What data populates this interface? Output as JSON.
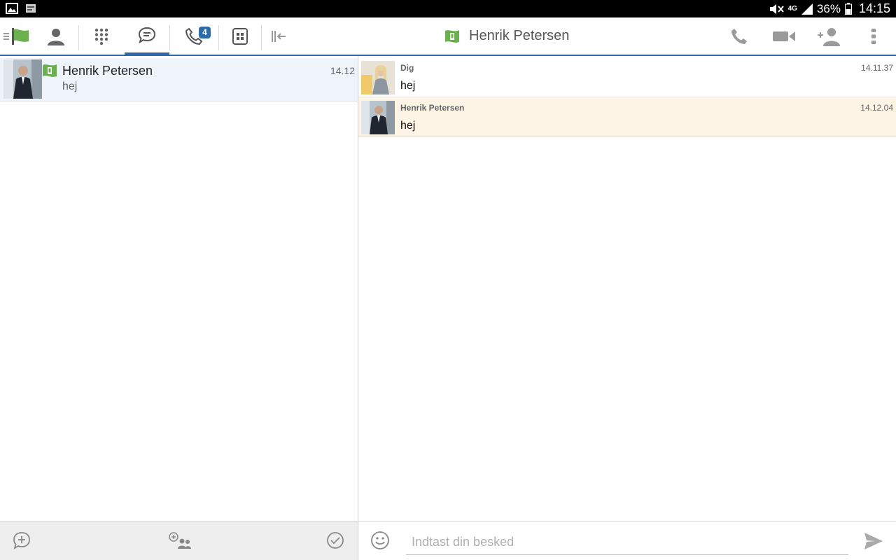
{
  "statusbar": {
    "network": "4G",
    "battery": "36%",
    "time": "14:15"
  },
  "toolbar": {
    "tabs": [
      {
        "name": "presence",
        "icon": "green-flag-icon"
      },
      {
        "name": "contacts",
        "icon": "person-icon"
      },
      {
        "name": "dialpad",
        "icon": "dialpad-icon"
      },
      {
        "name": "chat",
        "icon": "chat-bubble-icon",
        "active": true
      },
      {
        "name": "calls",
        "icon": "phone-icon",
        "badge": "4"
      },
      {
        "name": "switchboard",
        "icon": "building-icon"
      },
      {
        "name": "collapse",
        "icon": "collapse-panel-icon"
      }
    ],
    "badge_count": "4"
  },
  "header": {
    "contact_name": "Henrik Petersen",
    "status_icon": "mobile-presence-icon"
  },
  "conversations": [
    {
      "name": "Henrik Petersen",
      "preview": "hej",
      "time": "14.12"
    }
  ],
  "messages": [
    {
      "sender": "Dig",
      "text": "hej",
      "time": "14.11.37"
    },
    {
      "sender": "Henrik Petersen",
      "text": "hej",
      "time": "14.12.04"
    }
  ],
  "composer": {
    "placeholder": "Indtast din besked"
  },
  "colors": {
    "accent": "#2d6aa7",
    "presence_green": "#6ab04c",
    "incoming_bg": "#fdf4e6",
    "selected_bg": "#eef4fa"
  }
}
